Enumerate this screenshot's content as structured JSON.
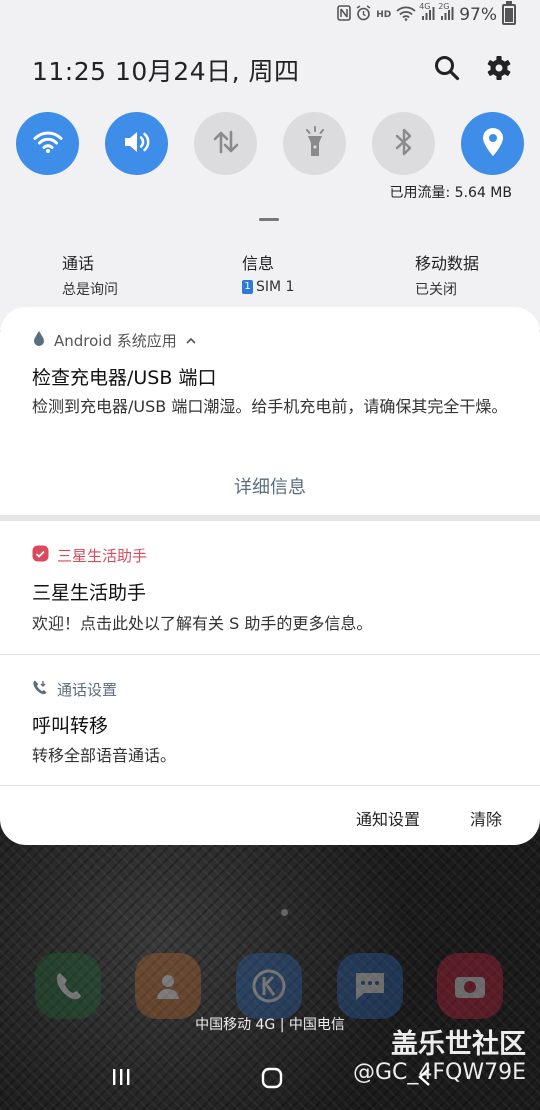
{
  "status_bar": {
    "network": "4G",
    "network2": "2G",
    "hd": "HD",
    "battery": "97%"
  },
  "header": {
    "datetime": "11:25  10月24日, 周四"
  },
  "quick_settings": {
    "data_usage": "已用流量: 5.64 MB",
    "toggles": [
      {
        "icon": "wifi-icon",
        "state": "on"
      },
      {
        "icon": "sound-icon",
        "state": "on"
      },
      {
        "icon": "mobile-data-icon",
        "state": "off"
      },
      {
        "icon": "flashlight-icon",
        "state": "off"
      },
      {
        "icon": "bluetooth-icon",
        "state": "off"
      },
      {
        "icon": "location-icon",
        "state": "on"
      }
    ]
  },
  "sim_info": {
    "call": {
      "title": "通话",
      "value": "总是询问"
    },
    "message": {
      "title": "信息",
      "sim_badge": "1",
      "value": "SIM 1"
    },
    "mobile_data": {
      "title": "移动数据",
      "value": "已关闭"
    }
  },
  "notifications": [
    {
      "app": "Android 系统应用",
      "title": "检查充电器/USB 端口",
      "body": "检测到充电器/USB 端口潮湿。给手机充电前，请确保其完全干燥。",
      "action": "详细信息"
    },
    {
      "app": "三星生活助手",
      "title": "三星生活助手",
      "body": "欢迎！点击此处以了解有关 S 助手的更多信息。"
    },
    {
      "app": "通话设置",
      "title": "呼叫转移",
      "body": "转移全部语音通话。"
    }
  ],
  "footer": {
    "settings": "通知设置",
    "clear": "清除"
  },
  "home": {
    "carrier": "中国移动 4G | 中国电信",
    "watermark_title": "盖乐世社区",
    "watermark_user": "@GC_4FQW79E"
  },
  "colors": {
    "accent": "#3e8ee9",
    "samsung_red": "#d84a5c"
  }
}
